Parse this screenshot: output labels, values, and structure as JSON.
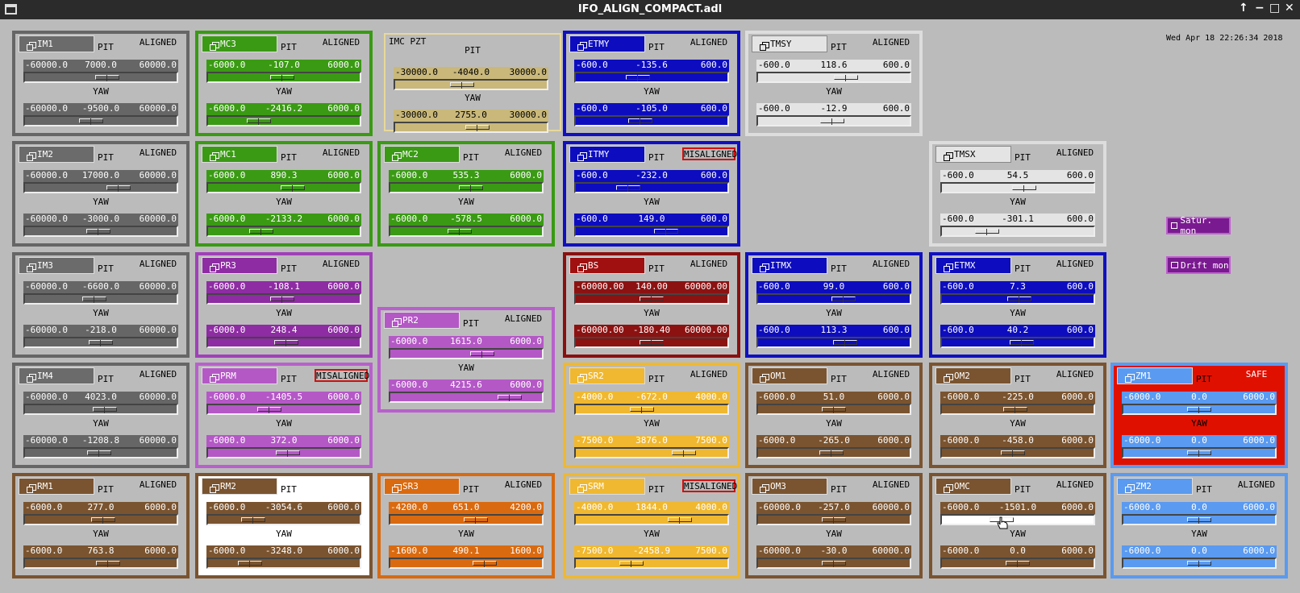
{
  "window": {
    "title": "IFO_ALIGN_COMPACT.adl",
    "controls": [
      "↑",
      "−",
      "□",
      "✕"
    ]
  },
  "timestamp": "Wed Apr 18 22:26:34 2018",
  "pit_label": "PIT",
  "yaw_label": "YAW",
  "pzt": {
    "title": "IMC PZT",
    "pit_label": "PIT",
    "yaw_label": "YAW",
    "pit": {
      "min": "-30000.0",
      "cur": "-4040.0",
      "max": "30000.0",
      "pos": 0.43
    },
    "yaw": {
      "min": "-30000.0",
      "cur": "2755.0",
      "max": "30000.0",
      "pos": 0.55
    },
    "colors": {
      "border": "#e8d89a",
      "bar": "#c9b87a",
      "text": "#000000"
    }
  },
  "external": {
    "satur_label": "Satur. mon",
    "drift_label": "Drift mon"
  },
  "themes": {
    "gray": {
      "border": "#666666",
      "btn": "#6b6b6b",
      "bar": "#666666",
      "text": "#ffffff"
    },
    "green": {
      "border": "#3a9a14",
      "btn": "#3a9a14",
      "bar": "#3a9a14",
      "text": "#ffffff"
    },
    "blue": {
      "border": "#1010c0",
      "btn": "#0d0dbf",
      "bar": "#0d0dbf",
      "text": "#ffffff"
    },
    "lightgray": {
      "border": "#dddddd",
      "btn": "#e4e4e4",
      "bar": "#e4e4e4",
      "text": "#000000"
    },
    "purple": {
      "border": "#a040b8",
      "btn": "#8e2ca3",
      "bar": "#8e2ca3",
      "text": "#ffffff"
    },
    "lightpurple": {
      "border": "#b860cc",
      "btn": "#b458c6",
      "bar": "#b458c6",
      "text": "#ffffff"
    },
    "darkred": {
      "border": "#8a1010",
      "btn": "#a01010",
      "bar": "#8c1212",
      "text": "#ffffff"
    },
    "yellow": {
      "border": "#f0b830",
      "btn": "#f0b830",
      "bar": "#f0b830",
      "text": "#ffffff"
    },
    "brown": {
      "border": "#7a5430",
      "btn": "#7a5430",
      "bar": "#7a5430",
      "text": "#ffffff"
    },
    "orange": {
      "border": "#d86a10",
      "btn": "#da6a10",
      "bar": "#da6a10",
      "text": "#ffffff"
    },
    "lightblue": {
      "border": "#5a9af0",
      "btn": "#5a9af0",
      "bar": "#5a9af0",
      "text": "#ffffff"
    }
  },
  "panels": [
    {
      "name": "IM1",
      "theme": "gray",
      "status": "ALIGNED",
      "pit": {
        "min": "-60000.0",
        "cur": "7000.0",
        "max": "60000.0",
        "pos": 0.55
      },
      "yaw": {
        "min": "-60000.0",
        "cur": "-9500.0",
        "max": "60000.0",
        "pos": 0.42
      }
    },
    {
      "name": "MC3",
      "theme": "green",
      "status": "ALIGNED",
      "pit": {
        "min": "-6000.0",
        "cur": "-107.0",
        "max": "6000.0",
        "pos": 0.49
      },
      "yaw": {
        "min": "-6000.0",
        "cur": "-2416.2",
        "max": "6000.0",
        "pos": 0.3
      }
    },
    {
      "name": "ETMY",
      "theme": "blue",
      "status": "ALIGNED",
      "pit": {
        "min": "-600.0",
        "cur": "-135.6",
        "max": "600.0",
        "pos": 0.39
      },
      "yaw": {
        "min": "-600.0",
        "cur": "-105.0",
        "max": "600.0",
        "pos": 0.41
      }
    },
    {
      "name": "TMSY",
      "theme": "lightgray",
      "status": "ALIGNED",
      "pit": {
        "min": "-600.0",
        "cur": "118.6",
        "max": "600.0",
        "pos": 0.6
      },
      "yaw": {
        "min": "-600.0",
        "cur": "-12.9",
        "max": "600.0",
        "pos": 0.49
      }
    },
    {
      "name": "IM2",
      "theme": "gray",
      "status": "ALIGNED",
      "pit": {
        "min": "-60000.0",
        "cur": "17000.0",
        "max": "60000.0",
        "pos": 0.64
      },
      "yaw": {
        "min": "-60000.0",
        "cur": "-3000.0",
        "max": "60000.0",
        "pos": 0.48
      }
    },
    {
      "name": "MC1",
      "theme": "green",
      "status": "ALIGNED",
      "pit": {
        "min": "-6000.0",
        "cur": "890.3",
        "max": "6000.0",
        "pos": 0.57
      },
      "yaw": {
        "min": "-6000.0",
        "cur": "-2133.2",
        "max": "6000.0",
        "pos": 0.32
      }
    },
    {
      "name": "MC2",
      "theme": "green",
      "status": "ALIGNED",
      "pit": {
        "min": "-6000.0",
        "cur": "535.3",
        "max": "6000.0",
        "pos": 0.54
      },
      "yaw": {
        "min": "-6000.0",
        "cur": "-578.5",
        "max": "6000.0",
        "pos": 0.45
      }
    },
    {
      "name": "ITMY",
      "theme": "blue",
      "status": "MISALIGNED",
      "pit": {
        "min": "-600.0",
        "cur": "-232.0",
        "max": "600.0",
        "pos": 0.31
      },
      "yaw": {
        "min": "-600.0",
        "cur": "149.0",
        "max": "600.0",
        "pos": 0.62
      }
    },
    {
      "name": "TMSX",
      "theme": "lightgray",
      "status": "ALIGNED",
      "pit": {
        "min": "-600.0",
        "cur": "54.5",
        "max": "600.0",
        "pos": 0.55
      },
      "yaw": {
        "min": "-600.0",
        "cur": "-301.1",
        "max": "600.0",
        "pos": 0.25
      }
    },
    {
      "name": "IM3",
      "theme": "gray",
      "status": "ALIGNED",
      "pit": {
        "min": "-60000.0",
        "cur": "-6600.0",
        "max": "60000.0",
        "pos": 0.45
      },
      "yaw": {
        "min": "-60000.0",
        "cur": "-218.0",
        "max": "60000.0",
        "pos": 0.5
      }
    },
    {
      "name": "PR3",
      "theme": "purple",
      "status": "ALIGNED",
      "pit": {
        "min": "-6000.0",
        "cur": "-108.1",
        "max": "6000.0",
        "pos": 0.49
      },
      "yaw": {
        "min": "-6000.0",
        "cur": "248.4",
        "max": "6000.0",
        "pos": 0.52
      }
    },
    {
      "name": "BS",
      "theme": "darkred",
      "status": "ALIGNED",
      "pit": {
        "min": "-60000.00",
        "cur": "140.00",
        "max": "60000.00",
        "pos": 0.5
      },
      "yaw": {
        "min": "-60000.00",
        "cur": "-180.40",
        "max": "60000.00",
        "pos": 0.5
      }
    },
    {
      "name": "ITMX",
      "theme": "blue",
      "status": "ALIGNED",
      "pit": {
        "min": "-600.0",
        "cur": "99.0",
        "max": "600.0",
        "pos": 0.58
      },
      "yaw": {
        "min": "-600.0",
        "cur": "113.3",
        "max": "600.0",
        "pos": 0.59
      }
    },
    {
      "name": "ETMX",
      "theme": "blue",
      "status": "ALIGNED",
      "pit": {
        "min": "-600.0",
        "cur": "7.3",
        "max": "600.0",
        "pos": 0.51
      },
      "yaw": {
        "min": "-600.0",
        "cur": "40.2",
        "max": "600.0",
        "pos": 0.53
      }
    },
    {
      "name": "PR2",
      "theme": "lightpurple",
      "status": "ALIGNED",
      "pit": {
        "min": "-6000.0",
        "cur": "1615.0",
        "max": "6000.0",
        "pos": 0.63
      },
      "yaw": {
        "min": "-6000.0",
        "cur": "4215.6",
        "max": "6000.0",
        "pos": 0.85
      }
    },
    {
      "name": "IM4",
      "theme": "gray",
      "status": "ALIGNED",
      "pit": {
        "min": "-60000.0",
        "cur": "4023.0",
        "max": "60000.0",
        "pos": 0.53
      },
      "yaw": {
        "min": "-60000.0",
        "cur": "-1208.8",
        "max": "60000.0",
        "pos": 0.49
      }
    },
    {
      "name": "PRM",
      "theme": "lightpurple",
      "status": "MISALIGNED",
      "pit": {
        "min": "-6000.0",
        "cur": "-1405.5",
        "max": "6000.0",
        "pos": 0.38
      },
      "yaw": {
        "min": "-6000.0",
        "cur": "372.0",
        "max": "6000.0",
        "pos": 0.53
      }
    },
    {
      "name": "SR2",
      "theme": "yellow",
      "status": "ALIGNED",
      "pit": {
        "min": "-4000.0",
        "cur": "-672.0",
        "max": "4000.0",
        "pos": 0.42
      },
      "yaw": {
        "min": "-7500.0",
        "cur": "3876.0",
        "max": "7500.0",
        "pos": 0.76
      }
    },
    {
      "name": "OM1",
      "theme": "brown",
      "status": "ALIGNED",
      "pit": {
        "min": "-6000.0",
        "cur": "51.0",
        "max": "6000.0",
        "pos": 0.5
      },
      "yaw": {
        "min": "-6000.0",
        "cur": "-265.0",
        "max": "6000.0",
        "pos": 0.48
      }
    },
    {
      "name": "OM2",
      "theme": "brown",
      "status": "ALIGNED",
      "pit": {
        "min": "-6000.0",
        "cur": "-225.0",
        "max": "6000.0",
        "pos": 0.48
      },
      "yaw": {
        "min": "-6000.0",
        "cur": "-458.0",
        "max": "6000.0",
        "pos": 0.46
      }
    },
    {
      "name": "ZM1",
      "theme": "lightblue",
      "status": "SAFE",
      "pit": {
        "min": "-6000.0",
        "cur": "0.0",
        "max": "6000.0",
        "pos": 0.5
      },
      "yaw": {
        "min": "-6000.0",
        "cur": "0.0",
        "max": "6000.0",
        "pos": 0.5
      }
    },
    {
      "name": "RM1",
      "theme": "brown",
      "status": "ALIGNED",
      "pit": {
        "min": "-6000.0",
        "cur": "277.0",
        "max": "6000.0",
        "pos": 0.52
      },
      "yaw": {
        "min": "-6000.0",
        "cur": "763.8",
        "max": "6000.0",
        "pos": 0.56
      }
    },
    {
      "name": "RM2",
      "theme": "brown",
      "status": "",
      "pit": {
        "min": "-6000.0",
        "cur": "-3054.6",
        "max": "6000.0",
        "pos": 0.25
      },
      "yaw": {
        "min": "-6000.0",
        "cur": "-3248.0",
        "max": "6000.0",
        "pos": 0.23
      }
    },
    {
      "name": "SR3",
      "theme": "orange",
      "status": "ALIGNED",
      "pit": {
        "min": "-4200.0",
        "cur": "651.0",
        "max": "4200.0",
        "pos": 0.58
      },
      "yaw": {
        "min": "-1600.0",
        "cur": "490.1",
        "max": "1600.0",
        "pos": 0.65
      }
    },
    {
      "name": "SRM",
      "theme": "yellow",
      "status": "MISALIGNED",
      "pit": {
        "min": "-4000.0",
        "cur": "1844.0",
        "max": "4000.0",
        "pos": 0.73
      },
      "yaw": {
        "min": "-7500.0",
        "cur": "-2458.9",
        "max": "7500.0",
        "pos": 0.34
      }
    },
    {
      "name": "OM3",
      "theme": "brown",
      "status": "ALIGNED",
      "pit": {
        "min": "-60000.0",
        "cur": "-257.0",
        "max": "60000.0",
        "pos": 0.5
      },
      "yaw": {
        "min": "-60000.0",
        "cur": "-30.0",
        "max": "60000.0",
        "pos": 0.5
      }
    },
    {
      "name": "OMC",
      "theme": "brown",
      "status": "ALIGNED",
      "pit": {
        "min": "-6000.0",
        "cur": "-1501.0",
        "max": "6000.0",
        "pos": 0.37,
        "bg": "#ffffff"
      },
      "yaw": {
        "min": "-6000.0",
        "cur": "0.0",
        "max": "6000.0",
        "pos": 0.5
      }
    },
    {
      "name": "ZM2",
      "theme": "lightblue",
      "status": "ALIGNED",
      "pit": {
        "min": "-6000.0",
        "cur": "0.0",
        "max": "6000.0",
        "pos": 0.5
      },
      "yaw": {
        "min": "-6000.0",
        "cur": "0.0",
        "max": "6000.0",
        "pos": 0.5
      }
    }
  ]
}
